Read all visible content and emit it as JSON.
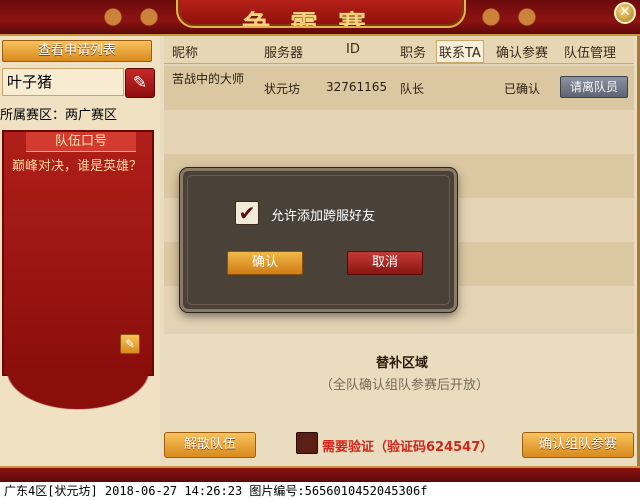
{
  "close_icon": "✕",
  "title_text": "争霸赛",
  "left": {
    "apply_list_btn": "查看申请列表",
    "team_name": "叶子猪",
    "edit_icon": "✎",
    "region": "所属赛区：两广赛区",
    "slogan_tab": "队伍口号",
    "slogan": "巅峰对决，谁是英雄？",
    "slogan_edit_icon": "✎",
    "disband_btn": "解散队伍"
  },
  "table": {
    "headers": [
      "昵称",
      "服务器",
      "ID",
      "职务",
      "联系TA",
      "确认参赛",
      "队伍管理"
    ],
    "rows": [
      {
        "nickname": "苦战中的大师",
        "server": "状元坊",
        "id": "32761165",
        "role": "队长",
        "status": "已确认",
        "action": "请离队员"
      }
    ]
  },
  "substitute": {
    "title": "替补区域",
    "note": "（全队确认组队参赛后开放）"
  },
  "verify": {
    "text": "需要验证（验证码624547）"
  },
  "confirm_team_btn": "确认组队参赛",
  "modal": {
    "checkbox_checked": true,
    "checkbox_label": "允许添加跨服好友",
    "ok_btn": "确认",
    "cancel_btn": "取消"
  },
  "status_bar": "广东4区[状元坊] 2018-06-27 14:26:23 图片编号:5656010452045306f"
}
